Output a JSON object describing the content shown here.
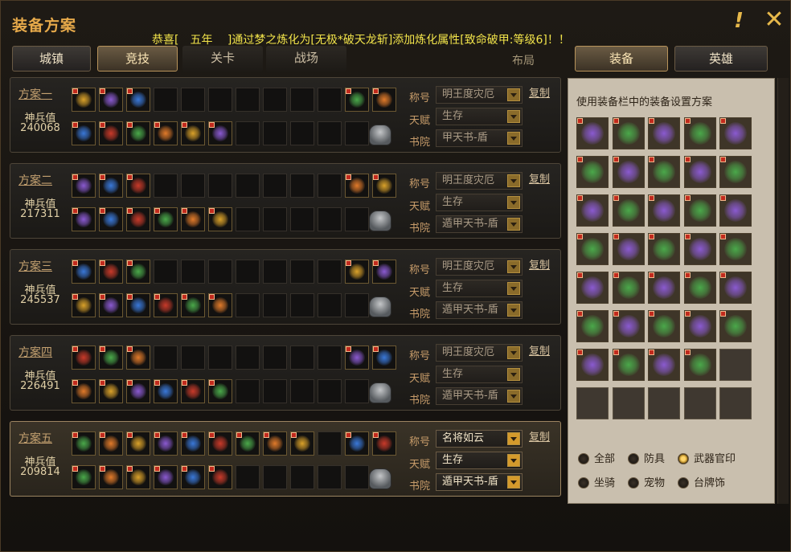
{
  "window": {
    "title": "装备方案",
    "broadcast": "恭喜[　五年　 ]通过梦之炼化为[无极*破天龙斩]添加炼化属性[致命破甲:等级6]！！",
    "help_icon": "!",
    "close_icon": "✕"
  },
  "tabs": [
    {
      "label": "城镇",
      "active": false
    },
    {
      "label": "竞技",
      "active": true
    },
    {
      "label": "关卡",
      "active": false,
      "style": "light"
    },
    {
      "label": "战场",
      "active": false,
      "style": "light"
    }
  ],
  "layout_label": "布局",
  "right_tabs": [
    {
      "label": "装备",
      "active": true
    },
    {
      "label": "英雄",
      "active": false
    }
  ],
  "field_labels": {
    "title": "称号",
    "talent": "天赋",
    "academy": "书院"
  },
  "plans": [
    {
      "name": "方案一",
      "power_label": "神兵值",
      "power": "240068",
      "title": "明王度灾厄",
      "talent": "生存",
      "academy": "甲天书-盾",
      "copy": "复制",
      "active": false,
      "row1": [
        1,
        1,
        1,
        0,
        0,
        0,
        0,
        0,
        0,
        0,
        1,
        1
      ],
      "row2": [
        1,
        1,
        1,
        1,
        1,
        1,
        0,
        0,
        0,
        0,
        0
      ]
    },
    {
      "name": "方案二",
      "power_label": "神兵值",
      "power": "217311",
      "title": "明王度灾厄",
      "talent": "生存",
      "academy": "遁甲天书-盾",
      "copy": "复制",
      "active": false,
      "row1": [
        1,
        1,
        1,
        0,
        0,
        0,
        0,
        0,
        0,
        0,
        1,
        1
      ],
      "row2": [
        1,
        1,
        1,
        1,
        1,
        1,
        0,
        0,
        0,
        0,
        0
      ]
    },
    {
      "name": "方案三",
      "power_label": "神兵值",
      "power": "245537",
      "title": "明王度灾厄",
      "talent": "生存",
      "academy": "遁甲天书-盾",
      "copy": "复制",
      "active": false,
      "row1": [
        1,
        1,
        1,
        0,
        0,
        0,
        0,
        0,
        0,
        0,
        1,
        1
      ],
      "row2": [
        1,
        1,
        1,
        1,
        1,
        1,
        0,
        0,
        0,
        0,
        0
      ]
    },
    {
      "name": "方案四",
      "power_label": "神兵值",
      "power": "226491",
      "title": "明王度灾厄",
      "talent": "生存",
      "academy": "遁甲天书-盾",
      "copy": "复制",
      "active": false,
      "row1": [
        1,
        1,
        1,
        0,
        0,
        0,
        0,
        0,
        0,
        0,
        1,
        1
      ],
      "row2": [
        1,
        1,
        1,
        1,
        1,
        1,
        0,
        0,
        0,
        0,
        0
      ]
    },
    {
      "name": "方案五",
      "power_label": "神兵值",
      "power": "209814",
      "title": "名将如云",
      "talent": "生存",
      "academy": "遁甲天书-盾",
      "copy": "复制",
      "active": true,
      "row1": [
        1,
        1,
        1,
        1,
        1,
        1,
        1,
        1,
        1,
        0,
        1,
        1
      ],
      "row2": [
        1,
        1,
        1,
        1,
        1,
        1,
        0,
        0,
        0,
        0,
        0
      ]
    }
  ],
  "inventory": {
    "hint": "使用装备栏中的装备设置方案",
    "filled_count": 34,
    "total": 40
  },
  "filters": [
    {
      "label": "全部",
      "selected": false
    },
    {
      "label": "防具",
      "selected": false
    },
    {
      "label": "武器官印",
      "selected": true
    },
    {
      "label": "坐骑",
      "selected": false
    },
    {
      "label": "宠物",
      "selected": false
    },
    {
      "label": "台牌饰",
      "selected": false
    }
  ],
  "colors": {
    "accent": "#e6a94a",
    "broadcast": "#f2e44a",
    "item_gold": "#d9a12a",
    "item_purple": "#8a5ad0",
    "item_blue": "#3a78d8",
    "item_red": "#c83a2a",
    "item_green": "#4aa84a"
  }
}
